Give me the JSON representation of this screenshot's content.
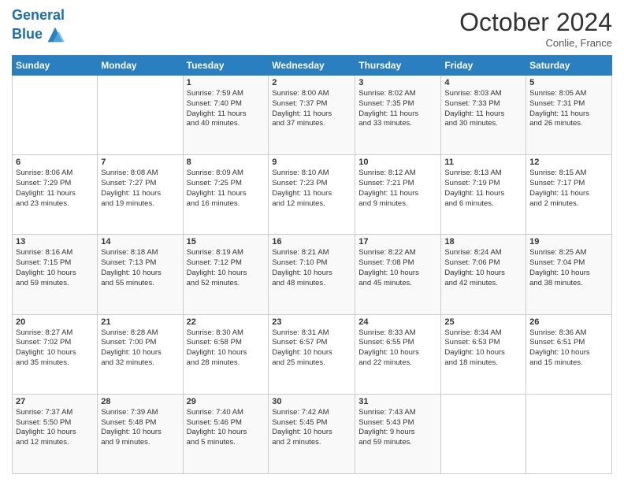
{
  "header": {
    "logo_line1": "General",
    "logo_line2": "Blue",
    "month": "October 2024",
    "location": "Conlie, France"
  },
  "weekdays": [
    "Sunday",
    "Monday",
    "Tuesday",
    "Wednesday",
    "Thursday",
    "Friday",
    "Saturday"
  ],
  "weeks": [
    [
      {
        "day": "",
        "info": ""
      },
      {
        "day": "",
        "info": ""
      },
      {
        "day": "1",
        "info": "Sunrise: 7:59 AM\nSunset: 7:40 PM\nDaylight: 11 hours\nand 40 minutes."
      },
      {
        "day": "2",
        "info": "Sunrise: 8:00 AM\nSunset: 7:37 PM\nDaylight: 11 hours\nand 37 minutes."
      },
      {
        "day": "3",
        "info": "Sunrise: 8:02 AM\nSunset: 7:35 PM\nDaylight: 11 hours\nand 33 minutes."
      },
      {
        "day": "4",
        "info": "Sunrise: 8:03 AM\nSunset: 7:33 PM\nDaylight: 11 hours\nand 30 minutes."
      },
      {
        "day": "5",
        "info": "Sunrise: 8:05 AM\nSunset: 7:31 PM\nDaylight: 11 hours\nand 26 minutes."
      }
    ],
    [
      {
        "day": "6",
        "info": "Sunrise: 8:06 AM\nSunset: 7:29 PM\nDaylight: 11 hours\nand 23 minutes."
      },
      {
        "day": "7",
        "info": "Sunrise: 8:08 AM\nSunset: 7:27 PM\nDaylight: 11 hours\nand 19 minutes."
      },
      {
        "day": "8",
        "info": "Sunrise: 8:09 AM\nSunset: 7:25 PM\nDaylight: 11 hours\nand 16 minutes."
      },
      {
        "day": "9",
        "info": "Sunrise: 8:10 AM\nSunset: 7:23 PM\nDaylight: 11 hours\nand 12 minutes."
      },
      {
        "day": "10",
        "info": "Sunrise: 8:12 AM\nSunset: 7:21 PM\nDaylight: 11 hours\nand 9 minutes."
      },
      {
        "day": "11",
        "info": "Sunrise: 8:13 AM\nSunset: 7:19 PM\nDaylight: 11 hours\nand 6 minutes."
      },
      {
        "day": "12",
        "info": "Sunrise: 8:15 AM\nSunset: 7:17 PM\nDaylight: 11 hours\nand 2 minutes."
      }
    ],
    [
      {
        "day": "13",
        "info": "Sunrise: 8:16 AM\nSunset: 7:15 PM\nDaylight: 10 hours\nand 59 minutes."
      },
      {
        "day": "14",
        "info": "Sunrise: 8:18 AM\nSunset: 7:13 PM\nDaylight: 10 hours\nand 55 minutes."
      },
      {
        "day": "15",
        "info": "Sunrise: 8:19 AM\nSunset: 7:12 PM\nDaylight: 10 hours\nand 52 minutes."
      },
      {
        "day": "16",
        "info": "Sunrise: 8:21 AM\nSunset: 7:10 PM\nDaylight: 10 hours\nand 48 minutes."
      },
      {
        "day": "17",
        "info": "Sunrise: 8:22 AM\nSunset: 7:08 PM\nDaylight: 10 hours\nand 45 minutes."
      },
      {
        "day": "18",
        "info": "Sunrise: 8:24 AM\nSunset: 7:06 PM\nDaylight: 10 hours\nand 42 minutes."
      },
      {
        "day": "19",
        "info": "Sunrise: 8:25 AM\nSunset: 7:04 PM\nDaylight: 10 hours\nand 38 minutes."
      }
    ],
    [
      {
        "day": "20",
        "info": "Sunrise: 8:27 AM\nSunset: 7:02 PM\nDaylight: 10 hours\nand 35 minutes."
      },
      {
        "day": "21",
        "info": "Sunrise: 8:28 AM\nSunset: 7:00 PM\nDaylight: 10 hours\nand 32 minutes."
      },
      {
        "day": "22",
        "info": "Sunrise: 8:30 AM\nSunset: 6:58 PM\nDaylight: 10 hours\nand 28 minutes."
      },
      {
        "day": "23",
        "info": "Sunrise: 8:31 AM\nSunset: 6:57 PM\nDaylight: 10 hours\nand 25 minutes."
      },
      {
        "day": "24",
        "info": "Sunrise: 8:33 AM\nSunset: 6:55 PM\nDaylight: 10 hours\nand 22 minutes."
      },
      {
        "day": "25",
        "info": "Sunrise: 8:34 AM\nSunset: 6:53 PM\nDaylight: 10 hours\nand 18 minutes."
      },
      {
        "day": "26",
        "info": "Sunrise: 8:36 AM\nSunset: 6:51 PM\nDaylight: 10 hours\nand 15 minutes."
      }
    ],
    [
      {
        "day": "27",
        "info": "Sunrise: 7:37 AM\nSunset: 5:50 PM\nDaylight: 10 hours\nand 12 minutes."
      },
      {
        "day": "28",
        "info": "Sunrise: 7:39 AM\nSunset: 5:48 PM\nDaylight: 10 hours\nand 9 minutes."
      },
      {
        "day": "29",
        "info": "Sunrise: 7:40 AM\nSunset: 5:46 PM\nDaylight: 10 hours\nand 5 minutes."
      },
      {
        "day": "30",
        "info": "Sunrise: 7:42 AM\nSunset: 5:45 PM\nDaylight: 10 hours\nand 2 minutes."
      },
      {
        "day": "31",
        "info": "Sunrise: 7:43 AM\nSunset: 5:43 PM\nDaylight: 9 hours\nand 59 minutes."
      },
      {
        "day": "",
        "info": ""
      },
      {
        "day": "",
        "info": ""
      }
    ]
  ]
}
